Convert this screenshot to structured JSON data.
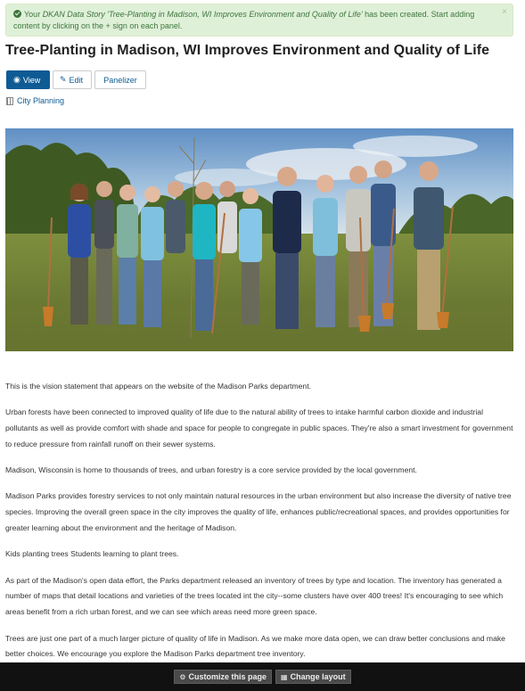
{
  "alert": {
    "prefix": "Your ",
    "type": "DKAN Data Story",
    "story_title": " 'Tree-Planting in Madison, WI Improves Environment and Quality of Life'",
    "suffix": " has been created. Start adding content by clicking on the + sign on each panel.",
    "close": "×",
    "color": "#3c763d"
  },
  "page": {
    "title": "Tree-Planting in Madison, WI Improves Environment and Quality of Life"
  },
  "tabs": [
    {
      "label": "View",
      "icon": "eye-icon",
      "active": true
    },
    {
      "label": "Edit",
      "icon": "edit-icon",
      "active": false
    },
    {
      "label": "Panelizer",
      "icon": "",
      "active": false
    }
  ],
  "topic": {
    "label": "City Planning",
    "icon": "building-icon"
  },
  "paragraphs": [
    "This is the vision statement that appears on the website of the Madison Parks department.",
    "Urban forests have been connected to improved quality of life due to the natural ability of trees to intake harmful carbon dioxide and industrial pollutants as well as provide comfort with shade and space for people to congregate in public spaces. They're also a smart investment for government to reduce pressure from rainfall runoff on their sewer systems.",
    "Madison, Wisconsin is home to thousands of trees, and urban forestry is a core service provided by the local government.",
    "Madison Parks provides forestry services to not only maintain natural resources in the urban environment but also increase the diversity of native tree species. Improving the overall green space in the city improves the quality of life, enhances public/recreational spaces, and provides opportunities for greater learning about the environment and the heritage of Madison.",
    "Kids planting trees Students learning to plant trees.",
    "As part of the Madison's open data effort, the Parks department released an inventory of trees by type and location. The inventory has generated a number of maps that detail locations and varieties of the trees located int the city--some clusters have over 400 trees! It's encouraging to see which areas benefit from a rich urban forest, and we can see which areas need more green space.",
    "Trees are just one part of a much larger picture of quality of life in Madison. As we make more data open, we can draw better conclusions and make better choices. We encourage you explore the Madison Parks department tree inventory."
  ],
  "footer": {
    "customize_label": "Customize this page",
    "customize_icon": "gear-icon",
    "layout_label": "Change layout",
    "layout_icon": "grid-icon"
  },
  "colors": {
    "accent": "#0e5b94",
    "alert_bg": "#dff0d8",
    "footer_bg": "#111111"
  }
}
